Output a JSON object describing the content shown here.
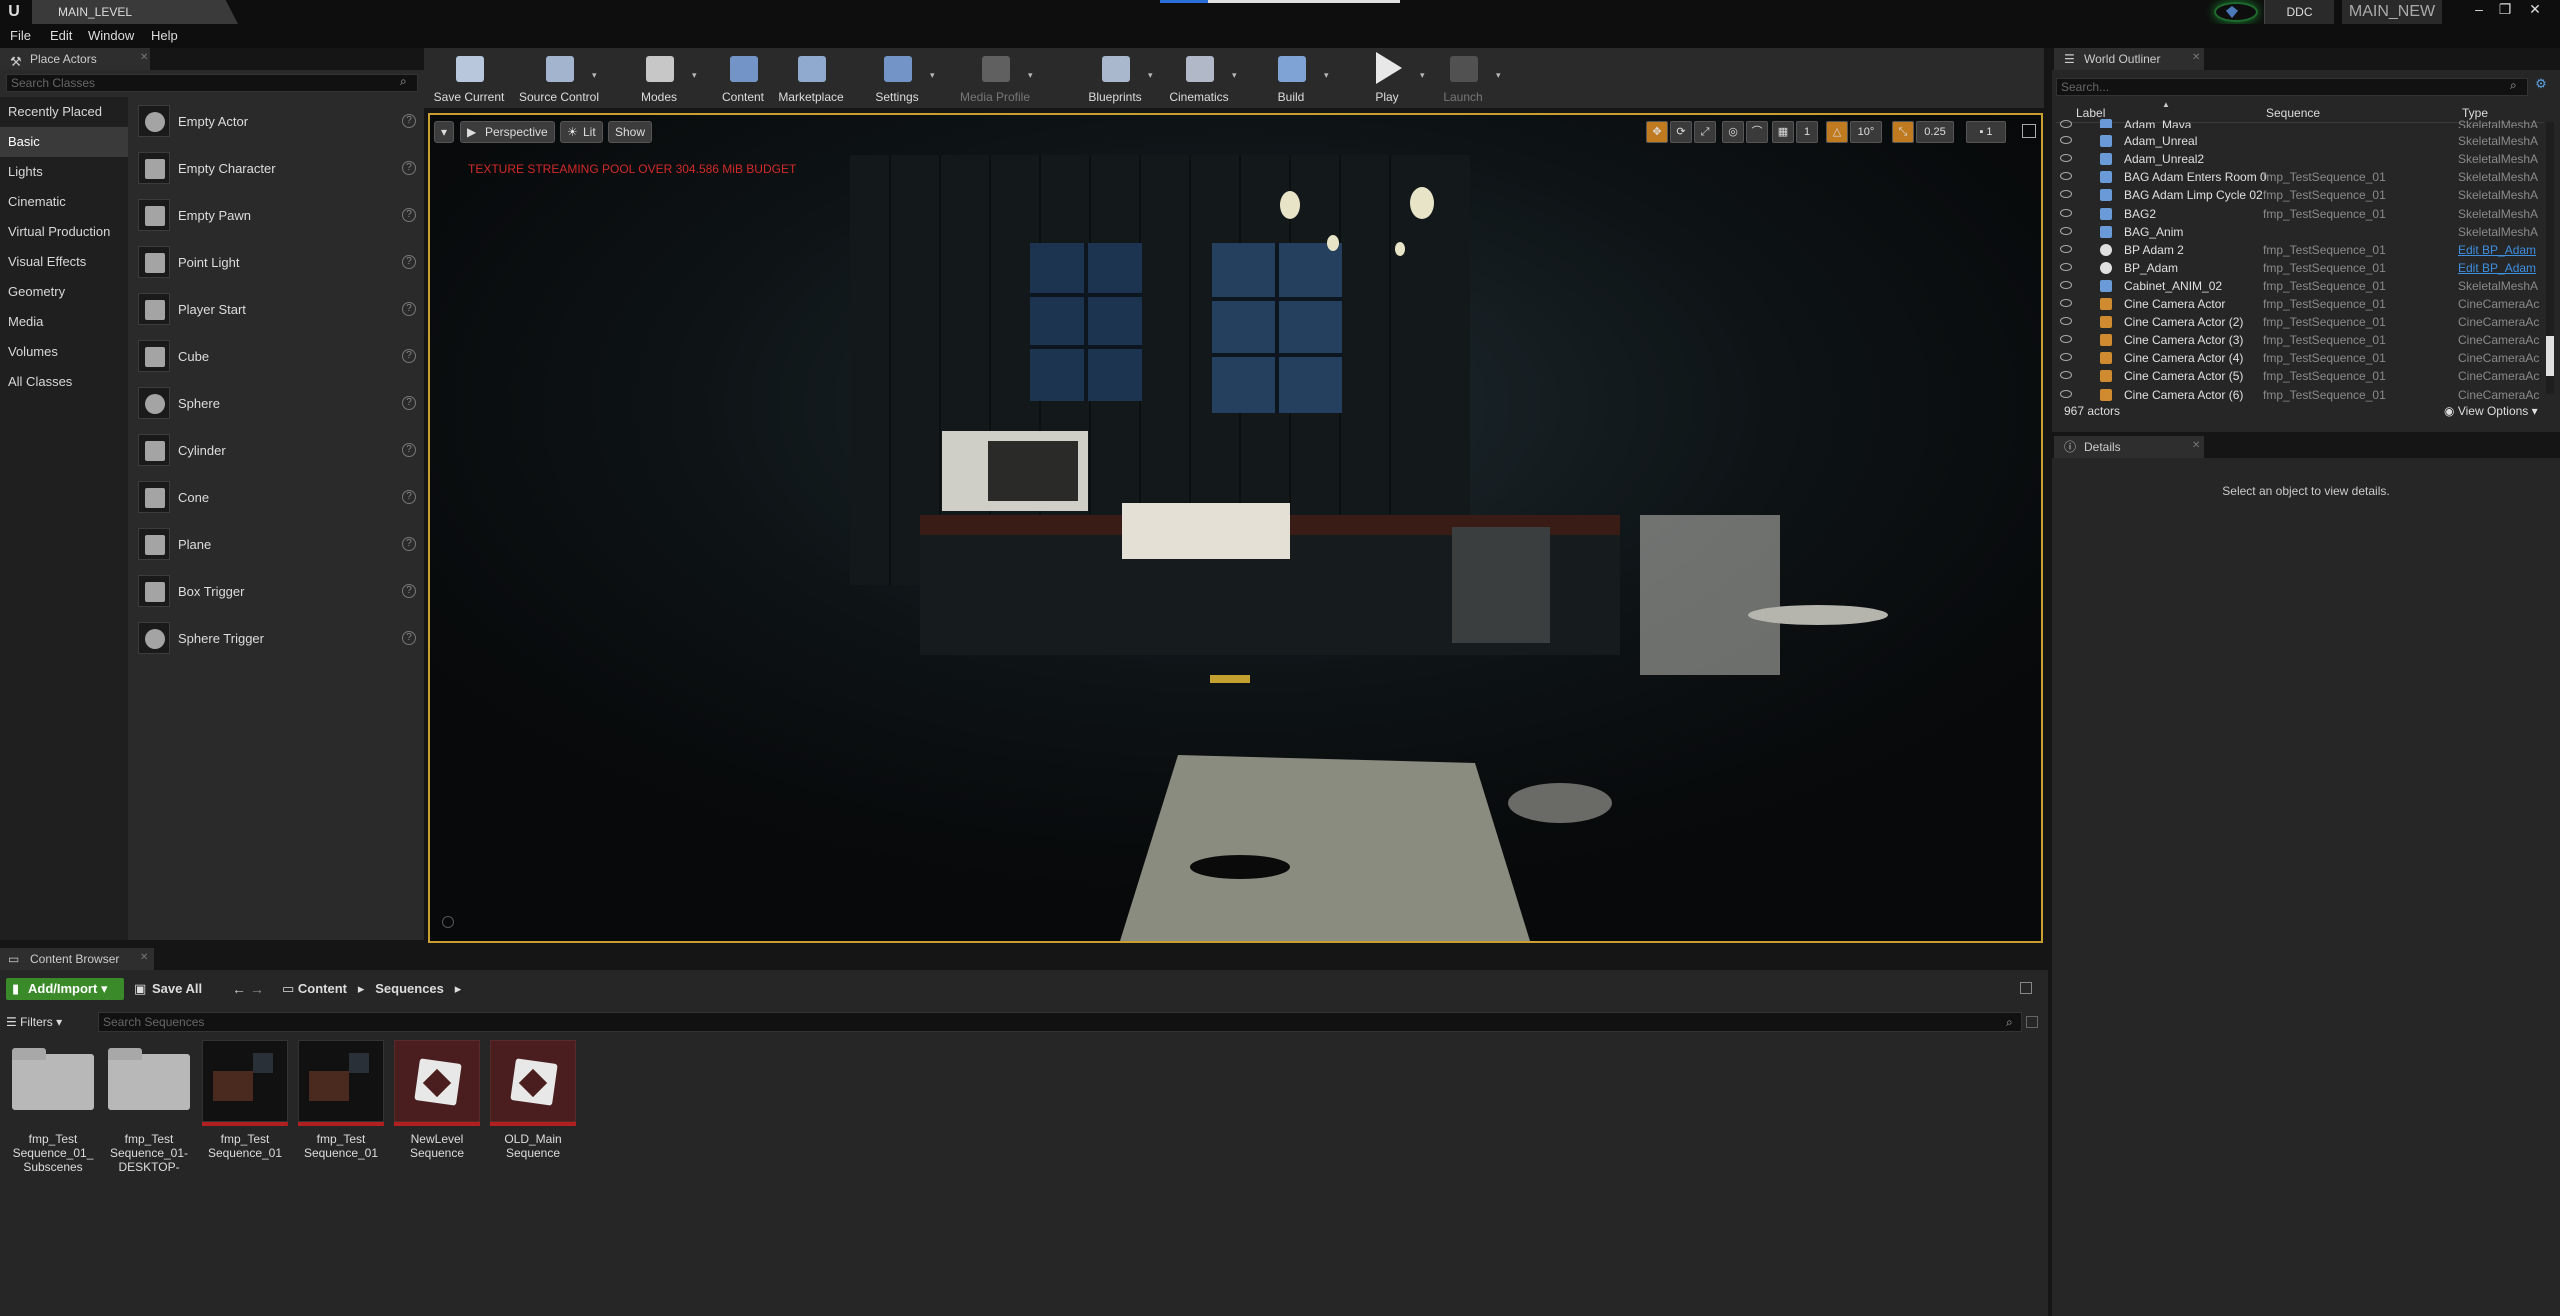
{
  "titlebar": {
    "level_tab": "MAIN_LEVEL",
    "ddc": "DDC",
    "project": "MAIN_NEW",
    "minimize": "–",
    "maximize": "❐",
    "close": "✕"
  },
  "menu": [
    "File",
    "Edit",
    "Window",
    "Help"
  ],
  "place_actors": {
    "tab": "Place Actors",
    "search_placeholder": "Search Classes",
    "categories": [
      "Recently Placed",
      "Basic",
      "Lights",
      "Cinematic",
      "Virtual Production",
      "Visual Effects",
      "Geometry",
      "Media",
      "Volumes",
      "All Classes"
    ],
    "active_category": "Basic",
    "actors": [
      "Empty Actor",
      "Empty Character",
      "Empty Pawn",
      "Point Light",
      "Player Start",
      "Cube",
      "Sphere",
      "Cylinder",
      "Cone",
      "Plane",
      "Box Trigger",
      "Sphere Trigger"
    ]
  },
  "toolbar": {
    "buttons": [
      "Save Current",
      "Source Control",
      "Modes",
      "Content",
      "Marketplace",
      "Settings",
      "Media Profile",
      "Blueprints",
      "Cinematics",
      "Build",
      "Play",
      "Launch"
    ]
  },
  "viewport": {
    "perspective": "Perspective",
    "lit": "Lit",
    "show": "Show",
    "warning": "TEXTURE STREAMING POOL OVER 304.586 MiB BUDGET",
    "angle": "10°",
    "scale": "0.25",
    "cam_speed": "1",
    "grid": "1"
  },
  "outliner": {
    "tab": "World Outliner",
    "search_placeholder": "Search...",
    "columns": {
      "label": "Label",
      "sequence": "Sequence",
      "type": "Type"
    },
    "rows": [
      {
        "label": "Adam_Maya",
        "seq": "",
        "type": "SkeletalMeshA"
      },
      {
        "label": "Adam_Unreal",
        "seq": "",
        "type": "SkeletalMeshA"
      },
      {
        "label": "Adam_Unreal2",
        "seq": "",
        "type": "SkeletalMeshA"
      },
      {
        "label": "BAG Adam Enters Room 0",
        "seq": "fmp_TestSequence_01",
        "type": "SkeletalMeshA"
      },
      {
        "label": "BAG Adam Limp Cycle 02",
        "seq": "fmp_TestSequence_01",
        "type": "SkeletalMeshA"
      },
      {
        "label": "BAG2",
        "seq": "fmp_TestSequence_01",
        "type": "SkeletalMeshA"
      },
      {
        "label": "BAG_Anim",
        "seq": "",
        "type": "SkeletalMeshA"
      },
      {
        "label": "BP Adam 2",
        "seq": "fmp_TestSequence_01",
        "type": "Edit BP_Adam"
      },
      {
        "label": "BP_Adam",
        "seq": "fmp_TestSequence_01",
        "type": "Edit BP_Adam"
      },
      {
        "label": "Cabinet_ANIM_02",
        "seq": "fmp_TestSequence_01",
        "type": "SkeletalMeshA"
      },
      {
        "label": "Cine Camera Actor",
        "seq": "fmp_TestSequence_01",
        "type": "CineCameraAc"
      },
      {
        "label": "Cine Camera Actor (2)",
        "seq": "fmp_TestSequence_01",
        "type": "CineCameraAc"
      },
      {
        "label": "Cine Camera Actor (3)",
        "seq": "fmp_TestSequence_01",
        "type": "CineCameraAc"
      },
      {
        "label": "Cine Camera Actor (4)",
        "seq": "fmp_TestSequence_01",
        "type": "CineCameraAc"
      },
      {
        "label": "Cine Camera Actor (5)",
        "seq": "fmp_TestSequence_01",
        "type": "CineCameraAc"
      },
      {
        "label": "Cine Camera Actor (6)",
        "seq": "fmp_TestSequence_01",
        "type": "CineCameraAc"
      }
    ],
    "count": "967 actors",
    "view_options": "View Options"
  },
  "details": {
    "tab": "Details",
    "message": "Select an object to view details."
  },
  "content_browser": {
    "tab": "Content Browser",
    "add_import": "Add/Import",
    "save_all": "Save All",
    "crumb_root": "Content",
    "crumb_folder": "Sequences",
    "filters": "Filters",
    "search_placeholder": "Search Sequences",
    "assets": [
      {
        "name": "fmp_Test Sequence_01_ Subscenes",
        "kind": "folder"
      },
      {
        "name": "fmp_Test Sequence_01- DESKTOP-",
        "kind": "folder"
      },
      {
        "name": "fmp_Test Sequence_01",
        "kind": "sequence-thumb"
      },
      {
        "name": "fmp_Test Sequence_01",
        "kind": "sequence-thumb"
      },
      {
        "name": "NewLevel Sequence",
        "kind": "level-sequence"
      },
      {
        "name": "OLD_Main Sequence",
        "kind": "level-sequence"
      }
    ]
  },
  "colors": {
    "accent_green": "#3a8a2a",
    "viewport_border": "#c8a030",
    "warning_red": "#d12a2a",
    "link_blue": "#3f8fe0"
  }
}
